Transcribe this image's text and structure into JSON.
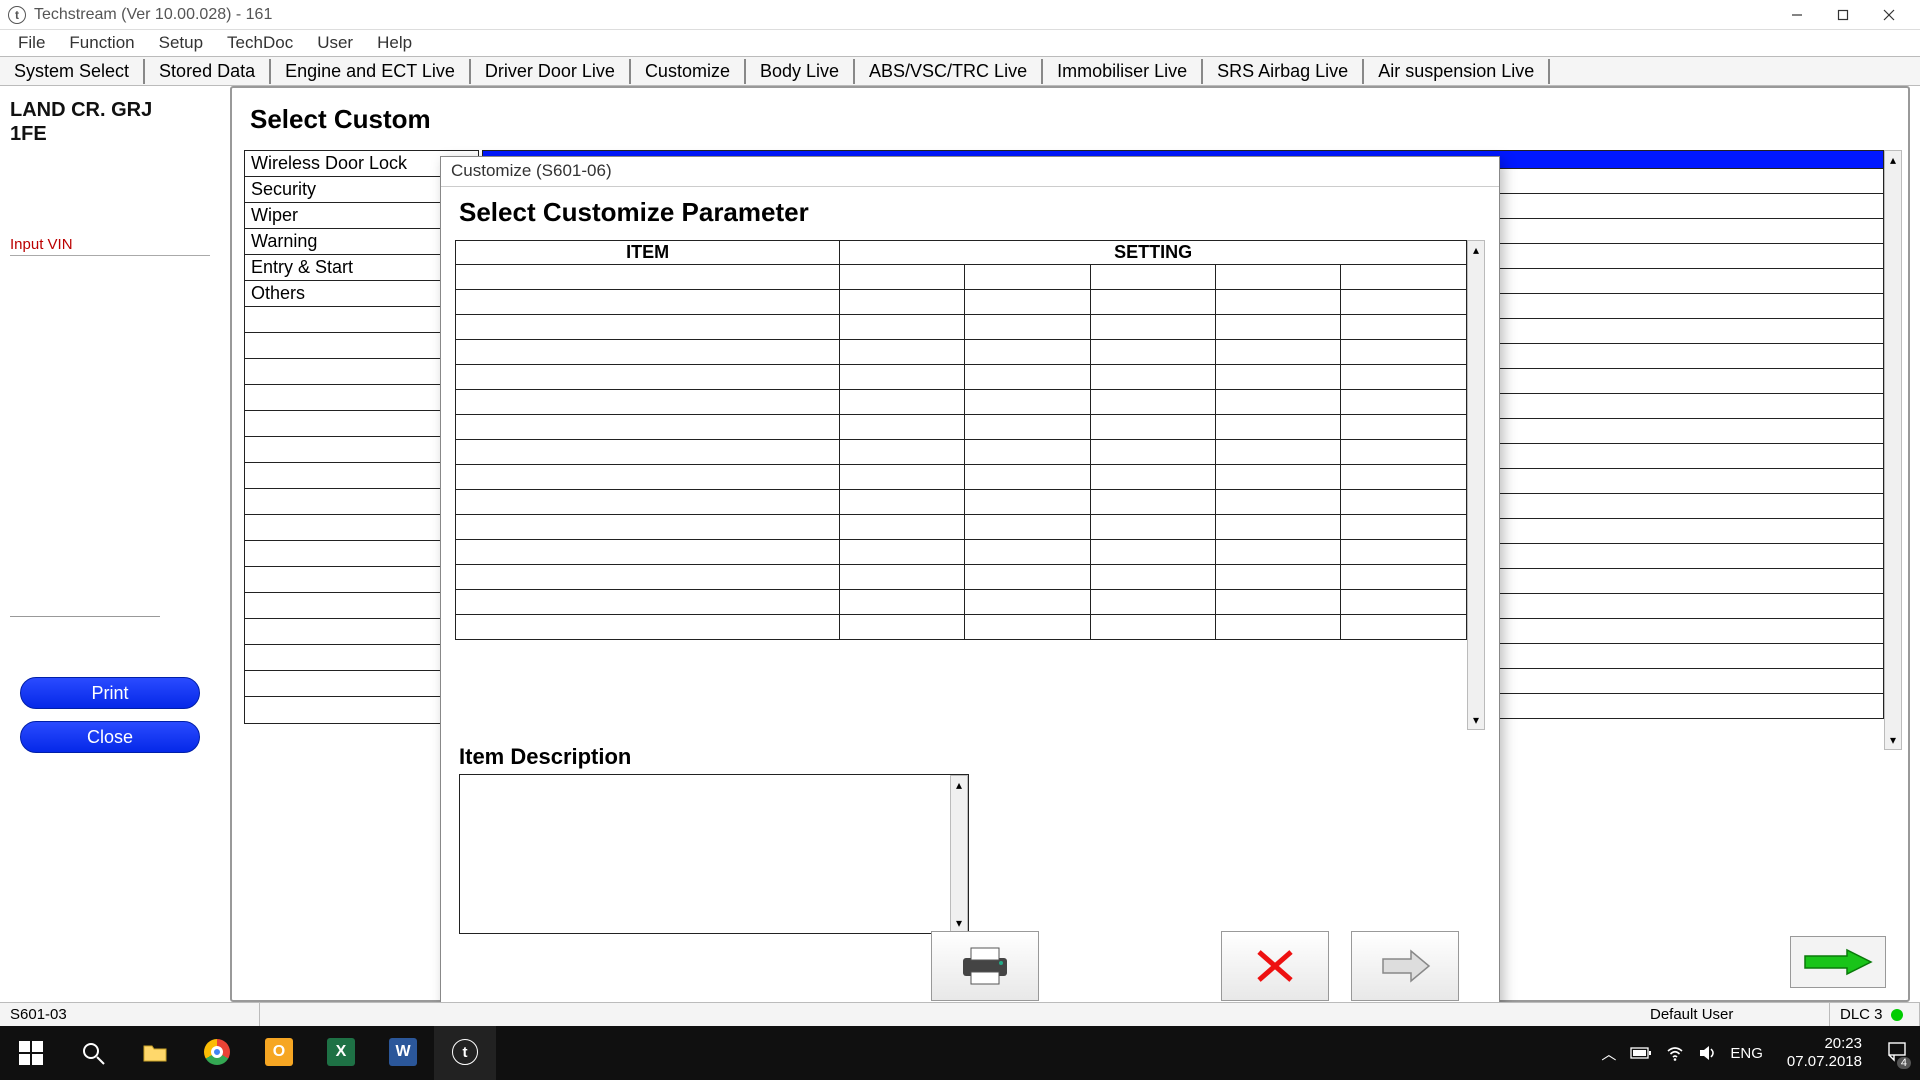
{
  "window": {
    "title": "Techstream (Ver 10.00.028) - 161"
  },
  "menubar": [
    "File",
    "Function",
    "Setup",
    "TechDoc",
    "User",
    "Help"
  ],
  "tabs": [
    "System Select",
    "Stored Data",
    "Engine and ECT Live",
    "Driver Door Live",
    "Customize",
    "Body Live",
    "ABS/VSC/TRC Live",
    "Immobiliser Live",
    "SRS Airbag Live",
    "Air suspension Live"
  ],
  "sidebar": {
    "vehicle_line1": "LAND CR. GRJ",
    "vehicle_line2": "1FE",
    "input_vin": "Input VIN",
    "print": "Print",
    "close": "Close"
  },
  "mainpanel": {
    "header": "Select Custom",
    "groups": [
      "Wireless Door Lock",
      "Security",
      "Wiper",
      "Warning",
      "Entry & Start",
      "Others"
    ]
  },
  "modal": {
    "title": "Customize (S601-06)",
    "header": "Select Customize Parameter",
    "col_item": "ITEM",
    "col_setting": "SETTING",
    "desc_label": "Item Description",
    "rows": 15,
    "setting_cols": 5
  },
  "statusbar": {
    "code": "S601-03",
    "user": "Default User",
    "dlc": "DLC 3"
  },
  "taskbar": {
    "lang": "ENG",
    "time": "20:23",
    "date": "07.07.2018",
    "notif_count": "4"
  }
}
